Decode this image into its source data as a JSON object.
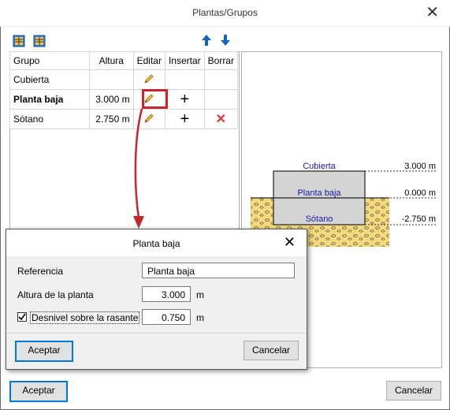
{
  "window": {
    "title": "Plantas/Grupos",
    "close": "✕"
  },
  "table": {
    "headers": [
      "Grupo",
      "Altura",
      "Editar",
      "Insertar",
      "Borrar"
    ],
    "rows": [
      {
        "grupo": "Cubierta",
        "altura": "",
        "insertar": "",
        "borrar": ""
      },
      {
        "grupo": "Planta baja",
        "altura": "3.000 m",
        "insertar": "+",
        "borrar": ""
      },
      {
        "grupo": "Sótano",
        "altura": "2.750 m",
        "insertar": "+",
        "borrar": "✕"
      }
    ]
  },
  "diagram": {
    "labels": [
      "Cubierta",
      "Planta baja",
      "Sótano"
    ],
    "levels": [
      "3.000 m",
      "0.000 m",
      "-2.750 m"
    ]
  },
  "dialog": {
    "title": "Planta baja",
    "close": "✕",
    "referencia_label": "Referencia",
    "referencia_value": "Planta baja",
    "altura_label": "Altura de la planta",
    "altura_value": "3.000",
    "altura_unit": "m",
    "desnivel_label": "Desnivel sobre la rasante",
    "desnivel_value": "0.750",
    "desnivel_unit": "m",
    "desnivel_checked": true,
    "accept": "Aceptar",
    "cancel": "Cancelar"
  },
  "footer": {
    "accept": "Aceptar",
    "cancel": "Cancelar"
  },
  "colors": {
    "accent": "#0078d7",
    "highlight": "#c4282e",
    "ground": "#f5d97b",
    "delete": "#d9363e"
  }
}
